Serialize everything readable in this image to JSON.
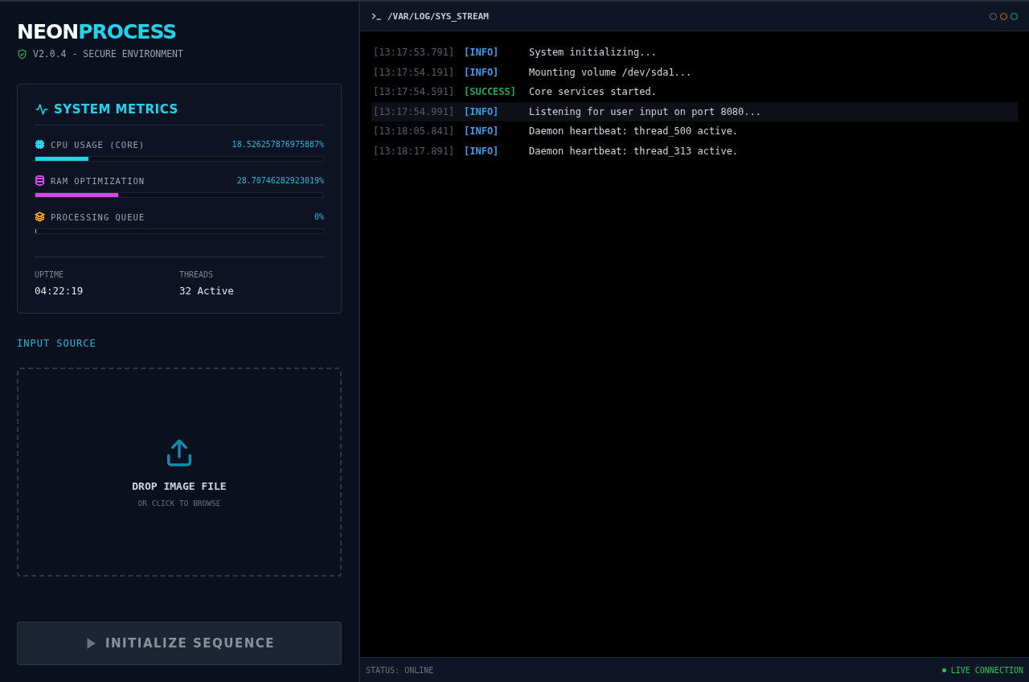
{
  "brand": {
    "part_1": "NEON",
    "part_2": "PROCESS",
    "subtitle": "V2.0.4 - SECURE ENVIRONMENT"
  },
  "metrics_card": {
    "title": "SYSTEM METRICS",
    "metrics": [
      {
        "kind": "cpu",
        "label": "CPU USAGE (CORE)",
        "reading": "18.526257876975887%",
        "level": 0.185,
        "color": "#22d3ee"
      },
      {
        "kind": "ram",
        "label": "RAM OPTIMIZATION",
        "reading": "28.70746282923019%",
        "level": 0.287,
        "color": "#d946ef"
      },
      {
        "kind": "queue",
        "label": "PROCESSING QUEUE",
        "reading": "0%",
        "level": 0,
        "color": "#f59e0b"
      }
    ],
    "stats": [
      {
        "label": "UPTIME",
        "value": "04:22:19"
      },
      {
        "label": "THREADS",
        "value": "32 Active"
      }
    ]
  },
  "input_source": {
    "heading": "INPUT SOURCE",
    "title": "DROP IMAGE FILE",
    "hint": "OR CLICK TO BROWSE"
  },
  "run_button": {
    "label": "INITIALIZE SEQUENCE",
    "disabled": true
  },
  "terminal": {
    "path": "/VAR/LOG/SYS_STREAM",
    "entries": [
      {
        "time": "[13:17:53.791]",
        "kind": "info",
        "tag": "[INFO]",
        "message": "System initializing...",
        "selected": false
      },
      {
        "time": "[13:17:54.191]",
        "kind": "info",
        "tag": "[INFO]",
        "message": "Mounting volume /dev/sda1...",
        "selected": false
      },
      {
        "time": "[13:17:54.591]",
        "kind": "success",
        "tag": "[SUCCESS]",
        "message": "Core services started.",
        "selected": false
      },
      {
        "time": "[13:17:54.991]",
        "kind": "info",
        "tag": "[INFO]",
        "message": "Listening for user input on port 8080...",
        "selected": true
      },
      {
        "time": "[13:18:05.841]",
        "kind": "info",
        "tag": "[INFO]",
        "message": "Daemon heartbeat: thread_500 active.",
        "selected": false
      },
      {
        "time": "[13:18:17.891]",
        "kind": "info",
        "tag": "[INFO]",
        "message": "Daemon heartbeat: thread_313 active.",
        "selected": false
      }
    ],
    "status": "STATUS: ONLINE",
    "connection": "LIVE CONNECTION"
  }
}
